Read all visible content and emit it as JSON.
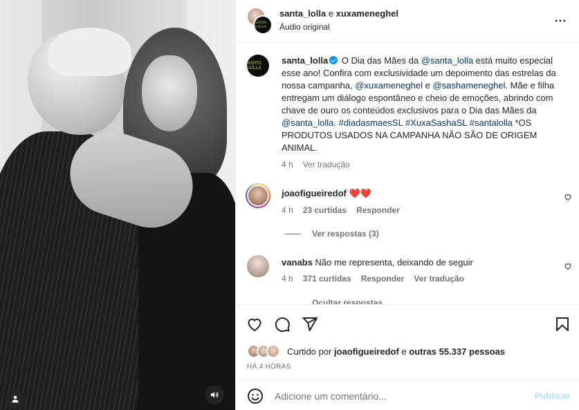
{
  "media": {
    "tag_icon": "user-tag-icon",
    "sound_icon": "speaker-icon"
  },
  "header": {
    "user1": "santa_lolla",
    "joiner": " e ",
    "user2": "xuxameneghel",
    "subtitle": "Áudio original",
    "logo_text": "SANTA LOLLA",
    "more_icon": "more-horizontal-icon"
  },
  "caption": {
    "username": "santa_lolla",
    "parts": {
      "t1": " O Dia das Mães da ",
      "m1": "@santa_lolla",
      "t2": " está muito especial esse ano! Confira com exclusividade um depoimento das estrelas da nossa campanha, ",
      "m2": "@xuxameneghel",
      "t3": " e ",
      "m3": "@sashameneghel",
      "t4": ". Mãe e filha entregam um diálogo espontâneo e cheio de emoções, abrindo com chave de ouro os conteúdos exclusivos para o Dia das Mães da ",
      "m4": "@santa_lolla",
      "t5": ". ",
      "h1": "#diadasmaesSL",
      "t6": " ",
      "h2": "#XuxaSashaSL",
      "t7": " ",
      "h3": "#santalolla",
      "t8": " *OS PRODUTOS USADOS NA CAMPANHA NÃO SÃO DE ORIGEM ANIMAL."
    },
    "time": "4 h",
    "translate": "Ver tradução"
  },
  "comments": [
    {
      "username": "joaofigueiredof",
      "text": "❤️❤️",
      "time": "4 h",
      "likes": "23 curtidas",
      "reply": "Responder",
      "view_replies": "Ver respostas (3)"
    },
    {
      "username": "vanabs",
      "text": "Não me representa, deixando de seguir",
      "time": "4 h",
      "likes": "371 curtidas",
      "reply": "Responder",
      "translate": "Ver tradução",
      "hide_replies": "Ocultar respostas"
    }
  ],
  "actions": {
    "like_icon": "heart-icon",
    "comment_icon": "comment-icon",
    "share_icon": "share-icon",
    "save_icon": "bookmark-icon",
    "liked_by_prefix": "Curtido por ",
    "liked_by_user": "joaofigueiredof",
    "liked_by_middle": " e ",
    "liked_by_others": "outras 55.337 pessoas",
    "time_ago": "HÁ 4 HORAS"
  },
  "composer": {
    "placeholder": "Adicione um comentário...",
    "post_label": "Publicar",
    "emoji_icon": "emoji-icon"
  }
}
